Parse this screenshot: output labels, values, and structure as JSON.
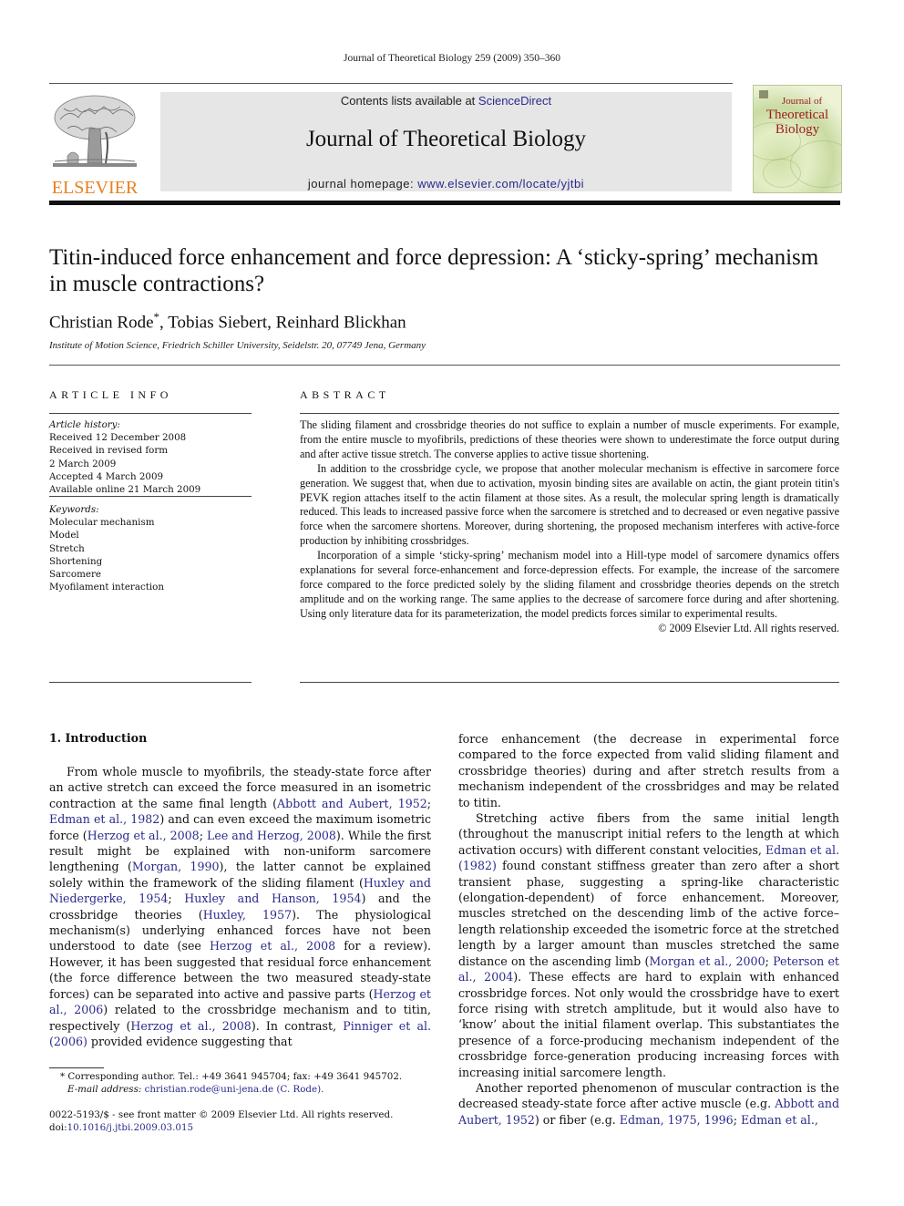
{
  "running_head": "Journal of Theoretical Biology 259 (2009) 350–360",
  "masthead": {
    "publisher_logo_text": "ELSEVIER",
    "contents_prefix": "Contents lists available at ",
    "contents_link": "ScienceDirect",
    "journal_name": "Journal of Theoretical Biology",
    "homepage_prefix": "journal homepage: ",
    "homepage_link": "www.elsevier.com/locate/yjtbi",
    "cover": {
      "line1": "Journal of",
      "line2": "Theoretical",
      "line3": "Biology"
    },
    "colors": {
      "elsevier_orange": "#e8801e",
      "link_blue": "#2a2a8c",
      "cover_title_red": "#9c1c1c",
      "banner_gray": "#e6e6e6"
    }
  },
  "article": {
    "title": "Titin-induced force enhancement and force depression: A ‘sticky-spring’ mechanism in muscle contractions?",
    "authors": [
      {
        "name": "Christian Rode",
        "mark": "*"
      },
      {
        "name": "Tobias Siebert",
        "mark": ""
      },
      {
        "name": "Reinhard Blickhan",
        "mark": ""
      }
    ],
    "author_sep": ", ",
    "affiliation": "Institute of Motion Science, Friedrich Schiller University, Seidelstr. 20, 07749 Jena, Germany"
  },
  "article_info": {
    "heading": "ARTICLE INFO",
    "history_label": "Article history:",
    "history": [
      "Received 12 December 2008",
      "Received in revised form",
      "2 March 2009",
      "Accepted 4 March 2009",
      "Available online 21 March 2009"
    ],
    "keywords_label": "Keywords:",
    "keywords": [
      "Molecular mechanism",
      "Model",
      "Stretch",
      "Shortening",
      "Sarcomere",
      "Myofilament interaction"
    ]
  },
  "abstract": {
    "heading": "ABSTRACT",
    "paragraphs": [
      "The sliding filament and crossbridge theories do not suffice to explain a number of muscle experiments. For example, from the entire muscle to myofibrils, predictions of these theories were shown to underestimate the force output during and after active tissue stretch. The converse applies to active tissue shortening.",
      "In addition to the crossbridge cycle, we propose that another molecular mechanism is effective in sarcomere force generation. We suggest that, when due to activation, myosin binding sites are available on actin, the giant protein titin's PEVK region attaches itself to the actin filament at those sites. As a result, the molecular spring length is dramatically reduced. This leads to increased passive force when the sarcomere is stretched and to decreased or even negative passive force when the sarcomere shortens. Moreover, during shortening, the proposed mechanism interferes with active-force production by inhibiting crossbridges.",
      "Incorporation of a simple ‘sticky-spring’ mechanism model into a Hill-type model of sarcomere dynamics offers explanations for several force-enhancement and force-depression effects. For example, the increase of the sarcomere force compared to the force predicted solely by the sliding filament and crossbridge theories depends on the stretch amplitude and on the working range. The same applies to the decrease of sarcomere force during and after shortening. Using only literature data for its parameterization, the model predicts forces similar to experimental results."
    ],
    "copyright": "© 2009 Elsevier Ltd. All rights reserved."
  },
  "body": {
    "section_heading": "1.  Introduction",
    "left_column": [
      [
        {
          "t": "From whole muscle to myofibrils, the steady-state force after an active stretch can exceed the force measured in an isometric contraction at the same final length ("
        },
        {
          "t": "Abbott and Aubert, 1952",
          "link": true
        },
        {
          "t": "; "
        },
        {
          "t": "Edman et al., 1982",
          "link": true
        },
        {
          "t": ") and can even exceed the maximum isometric force ("
        },
        {
          "t": "Herzog et al., 2008",
          "link": true
        },
        {
          "t": "; "
        },
        {
          "t": "Lee and Herzog, 2008",
          "link": true
        },
        {
          "t": "). While the first result might be explained with non-uniform sarcomere lengthening ("
        },
        {
          "t": "Morgan, 1990",
          "link": true
        },
        {
          "t": "), the latter cannot be explained solely within the framework of the sliding filament ("
        },
        {
          "t": "Huxley and Niedergerke, 1954",
          "link": true
        },
        {
          "t": "; "
        },
        {
          "t": "Huxley and Hanson, 1954",
          "link": true
        },
        {
          "t": ") and the crossbridge theories ("
        },
        {
          "t": "Huxley, 1957",
          "link": true
        },
        {
          "t": "). The physiological mechanism(s) underlying enhanced forces have not been understood to date (see "
        },
        {
          "t": "Herzog et al., 2008",
          "link": true
        },
        {
          "t": " for a review). However, it has been suggested that residual force enhancement (the force difference between the two measured steady-state forces) can be separated into active and passive parts ("
        },
        {
          "t": "Herzog et al., 2006",
          "link": true
        },
        {
          "t": ") related to the crossbridge mechanism and to titin, respectively ("
        },
        {
          "t": "Herzog et al., 2008",
          "link": true
        },
        {
          "t": "). In contrast, "
        },
        {
          "t": "Pinniger et al. (2006)",
          "link": true
        },
        {
          "t": " provided evidence suggesting that"
        }
      ]
    ],
    "right_column": [
      [
        {
          "t": "force enhancement (the decrease in experimental force compared to the force expected from valid sliding filament and crossbridge theories) during and after stretch results from a mechanism independent of the crossbridges and may be related to titin."
        }
      ],
      [
        {
          "t": "Stretching active fibers from the same initial length (throughout the manuscript initial refers to the length at which activation occurs) with different constant velocities, "
        },
        {
          "t": "Edman et al. (1982)",
          "link": true
        },
        {
          "t": " found constant stiffness greater than zero after a short transient phase, suggesting a spring-like characteristic (elongation-dependent) of force enhancement. Moreover, muscles stretched on the descending limb of the active force–length relationship exceeded the isometric force at the stretched length by a larger amount than muscles stretched the same distance on the ascending limb ("
        },
        {
          "t": "Morgan et al., 2000",
          "link": true
        },
        {
          "t": "; "
        },
        {
          "t": "Peterson et al., 2004",
          "link": true
        },
        {
          "t": "). These effects are hard to explain with enhanced crossbridge forces. Not only would the crossbridge have to exert force rising with stretch amplitude, but it would also have to ‘know’ about the initial filament overlap. This substantiates the presence of a force-producing mechanism independent of the crossbridge force-generation producing increasing forces with increasing initial sarcomere length."
        }
      ],
      [
        {
          "t": "Another reported phenomenon of muscular contraction is the decreased steady-state force after active muscle (e.g. "
        },
        {
          "t": "Abbott and Aubert, 1952",
          "link": true
        },
        {
          "t": ") or fiber (e.g. "
        },
        {
          "t": "Edman, 1975, 1996",
          "link": true
        },
        {
          "t": "; "
        },
        {
          "t": "Edman et al.,",
          "link": true
        }
      ]
    ]
  },
  "footnotes": {
    "corresponding": "* Corresponding author. Tel.: +49 3641 945704; fax: +49 3641 945702.",
    "email_label": "E-mail address: ",
    "email": "christian.rode@uni-jena.de (C. Rode).",
    "front_matter": "0022-5193/$ - see front matter © 2009 Elsevier Ltd. All rights reserved.",
    "doi_prefix": "doi:",
    "doi": "10.1016/j.jtbi.2009.03.015"
  }
}
